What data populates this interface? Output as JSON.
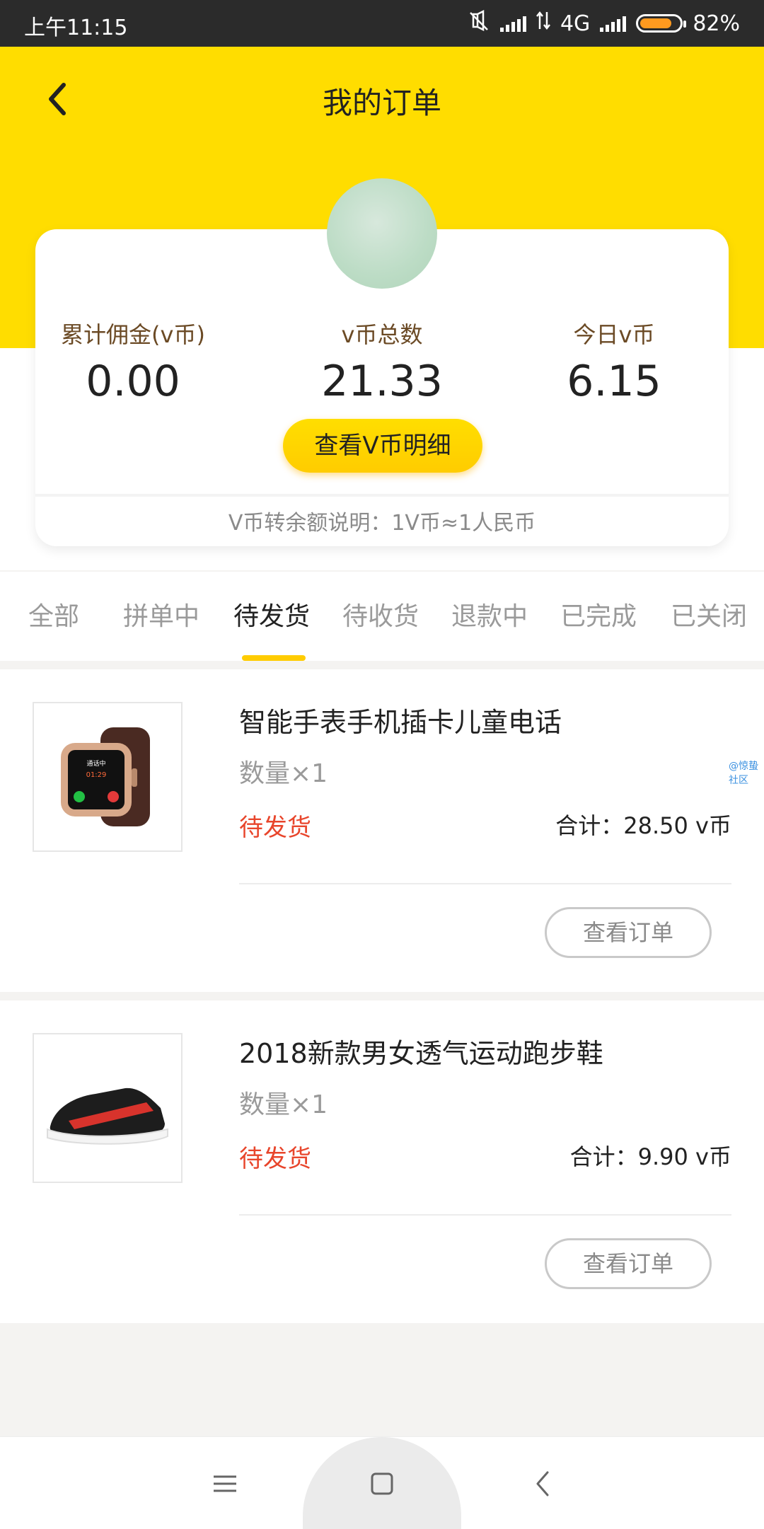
{
  "status_bar": {
    "time": "上午11:15",
    "network": "4G",
    "battery": "82%"
  },
  "header": {
    "title": "我的订单",
    "back_icon": "chevron-left-icon"
  },
  "stats": {
    "commission_label": "累计佣金(v币)",
    "commission_value": "0.00",
    "total_label": "v币总数",
    "total_value": "21.33",
    "today_label": "今日v币",
    "today_value": "6.15",
    "detail_button": "查看V币明细",
    "note": "V币转余额说明：1V币≈1人民币"
  },
  "tabs": [
    {
      "label": "全部"
    },
    {
      "label": "拼单中"
    },
    {
      "label": "待发货"
    },
    {
      "label": "待收货"
    },
    {
      "label": "退款中"
    },
    {
      "label": "已完成"
    },
    {
      "label": "已关闭"
    }
  ],
  "active_tab": "待发货",
  "orders": [
    {
      "title": "智能手表手机插卡儿童电话",
      "quantity": "数量×1",
      "status": "待发货",
      "total": "合计：28.50 v币",
      "button": "查看订单",
      "watermark": "@惊蛰社区"
    },
    {
      "title": "2018新款男女透气运动跑步鞋",
      "quantity": "数量×1",
      "status": "待发货",
      "total": "合计：9.90 v币",
      "button": "查看订单"
    }
  ],
  "colors": {
    "accent": "#ffdd00",
    "status_red": "#e8452b"
  }
}
